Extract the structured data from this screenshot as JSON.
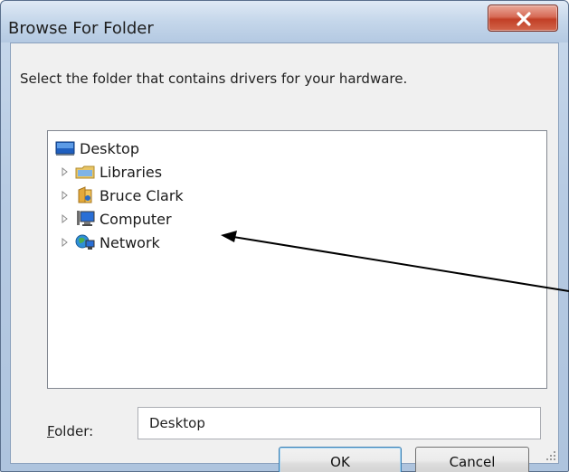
{
  "window": {
    "title": "Browse For Folder",
    "close_icon": "close-icon"
  },
  "dialog": {
    "instructions": "Select the folder that contains drivers for your hardware."
  },
  "tree": {
    "items": [
      {
        "label": "Desktop",
        "icon": "desktop-icon",
        "expandable": false,
        "selected": true
      },
      {
        "label": "Libraries",
        "icon": "libraries-icon",
        "expandable": true
      },
      {
        "label": "Bruce Clark",
        "icon": "user-folder-icon",
        "expandable": true
      },
      {
        "label": "Computer",
        "icon": "computer-icon",
        "expandable": true
      },
      {
        "label": "Network",
        "icon": "network-icon",
        "expandable": true
      }
    ]
  },
  "folder": {
    "label_prefix": "",
    "label_accel": "F",
    "label_rest": "older:",
    "value": "Desktop"
  },
  "buttons": {
    "ok": "OK",
    "cancel": "Cancel"
  },
  "colors": {
    "titlebar": "#c4d6ea",
    "close_button": "#c23f26",
    "client": "#f0f0f0",
    "ok_border": "#3c7fb1"
  }
}
